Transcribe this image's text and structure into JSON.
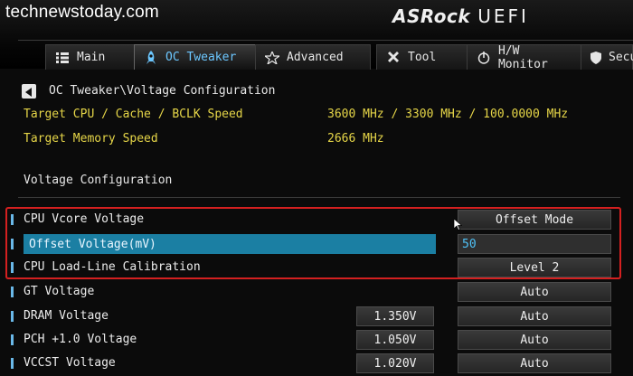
{
  "watermark": "technewstoday.com",
  "brand": {
    "name": "ASRock",
    "product": "UEFI"
  },
  "tabs": [
    {
      "label": "Main",
      "icon": "list-icon",
      "active": false
    },
    {
      "label": "OC Tweaker",
      "icon": "rocket-icon",
      "active": true
    },
    {
      "label": "Advanced",
      "icon": "star-icon",
      "active": false
    },
    {
      "label": "Tool",
      "icon": "tools-icon",
      "active": false
    },
    {
      "label": "H/W Monitor",
      "icon": "power-icon",
      "active": false
    },
    {
      "label": "Secu",
      "icon": "shield-icon",
      "active": false
    }
  ],
  "breadcrumb": "OC Tweaker\\Voltage Configuration",
  "info": [
    {
      "label": "Target CPU / Cache / BCLK Speed",
      "value": "3600 MHz / 3300 MHz / 100.0000 MHz"
    },
    {
      "label": "Target Memory Speed",
      "value": "2666 MHz"
    }
  ],
  "section_title": "Voltage Configuration",
  "items": [
    {
      "label": "CPU Vcore Voltage",
      "voltage": "",
      "value": "Offset Mode",
      "selected": false,
      "input": false
    },
    {
      "label": "Offset Voltage(mV)",
      "voltage": "",
      "value": "50",
      "selected": true,
      "input": true
    },
    {
      "label": "CPU Load-Line Calibration",
      "voltage": "",
      "value": "Level 2",
      "selected": false,
      "input": false
    },
    {
      "label": "GT Voltage",
      "voltage": "",
      "value": "Auto",
      "selected": false,
      "input": false
    },
    {
      "label": "DRAM Voltage",
      "voltage": "1.350V",
      "value": "Auto",
      "selected": false,
      "input": false
    },
    {
      "label": "PCH +1.0 Voltage",
      "voltage": "1.050V",
      "value": "Auto",
      "selected": false,
      "input": false
    },
    {
      "label": "VCCST Voltage",
      "voltage": "1.020V",
      "value": "Auto",
      "selected": false,
      "input": false
    }
  ],
  "colors": {
    "accent": "#6cc7ff",
    "info_text": "#e6d648",
    "selection": "#1b7fa3",
    "highlight_frame": "#d42020"
  }
}
